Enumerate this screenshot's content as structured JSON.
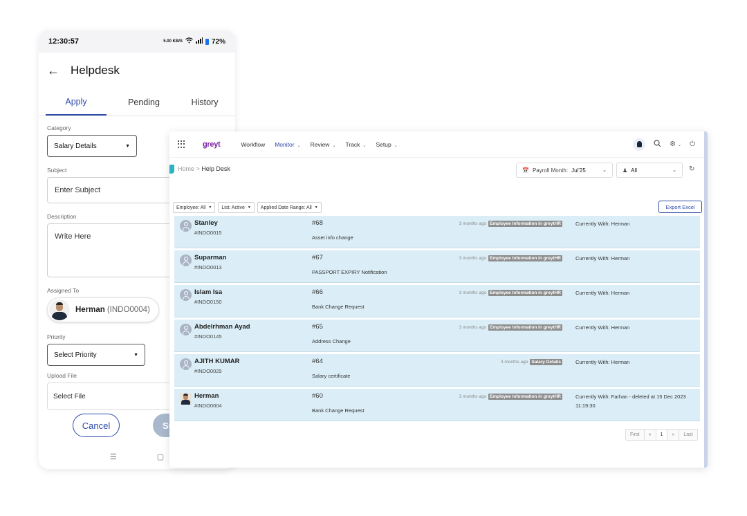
{
  "phone": {
    "status": {
      "time": "12:30:57",
      "indicators": "5.00 KB/S",
      "battery": "72%"
    },
    "title": "Helpdesk",
    "tabs": [
      "Apply",
      "Pending",
      "History"
    ],
    "category_label": "Category",
    "category_value": "Salary Details",
    "subject_label": "Subject",
    "subject_placeholder": "Enter Subject",
    "description_label": "Description",
    "description_placeholder": "Write Here",
    "assigned_label": "Assigned To",
    "assigned_name": "Herman",
    "assigned_code": "(INDO0004)",
    "priority_label": "Priority",
    "priority_placeholder": "Select Priority",
    "upload_label": "Upload File",
    "upload_placeholder": "Select File",
    "cancel_label": "Cancel",
    "submit_label": "Submit"
  },
  "web": {
    "logo": "greyt",
    "menu": [
      "Workflow",
      "Monitor",
      "Review",
      "Track",
      "Setup"
    ],
    "breadcrumb_home": "Home",
    "breadcrumb_sep": ">",
    "breadcrumb_current": "Help Desk",
    "payroll_label": "Payroll Month:",
    "payroll_value": "Jul'25",
    "group_value": "All",
    "filters": [
      "Employee: All",
      "List: Active",
      "Applied Date Range: All"
    ],
    "export_label": "Export Excel",
    "rows": [
      {
        "name": "Stanley",
        "id": "#INDO0015",
        "num": "#68",
        "subject": "Asset info change",
        "ago": "3 months ago",
        "tag": "Employee Information in greytHR",
        "with": "Currently With: Herman"
      },
      {
        "name": "Suparman",
        "id": "#INDO0013",
        "num": "#67",
        "subject": "PASSPORT EXPIRY Notification",
        "ago": "3 months ago",
        "tag": "Employee Information in greytHR",
        "with": "Currently With: Herman"
      },
      {
        "name": "Islam Isa",
        "id": "#INDO0150",
        "num": "#66",
        "subject": "Bank Change Request",
        "ago": "3 months ago",
        "tag": "Employee Information in greytHR",
        "with": "Currently With: Herman"
      },
      {
        "name": "Abdelrhman Ayad",
        "id": "#INDO0145",
        "num": "#65",
        "subject": "Address Change",
        "ago": "3 months ago",
        "tag": "Employee Information in greytHR",
        "with": "Currently With: Herman"
      },
      {
        "name": "AJITH KUMAR",
        "id": "#INDO0029",
        "num": "#64",
        "subject": "Salary certificate",
        "ago": "3 months ago",
        "tag": "Salary Details",
        "with": "Currently With: Herman"
      },
      {
        "name": "Herman",
        "id": "#INDO0004",
        "num": "#60",
        "subject": "Bank Change Request",
        "ago": "3 months ago",
        "tag": "Employee Information in greytHR",
        "with": "Currently With: Farhan - deleted at 15 Dec 2023 11:19:30"
      }
    ],
    "pager": [
      "First",
      "«",
      "1",
      "»",
      "Last"
    ]
  }
}
